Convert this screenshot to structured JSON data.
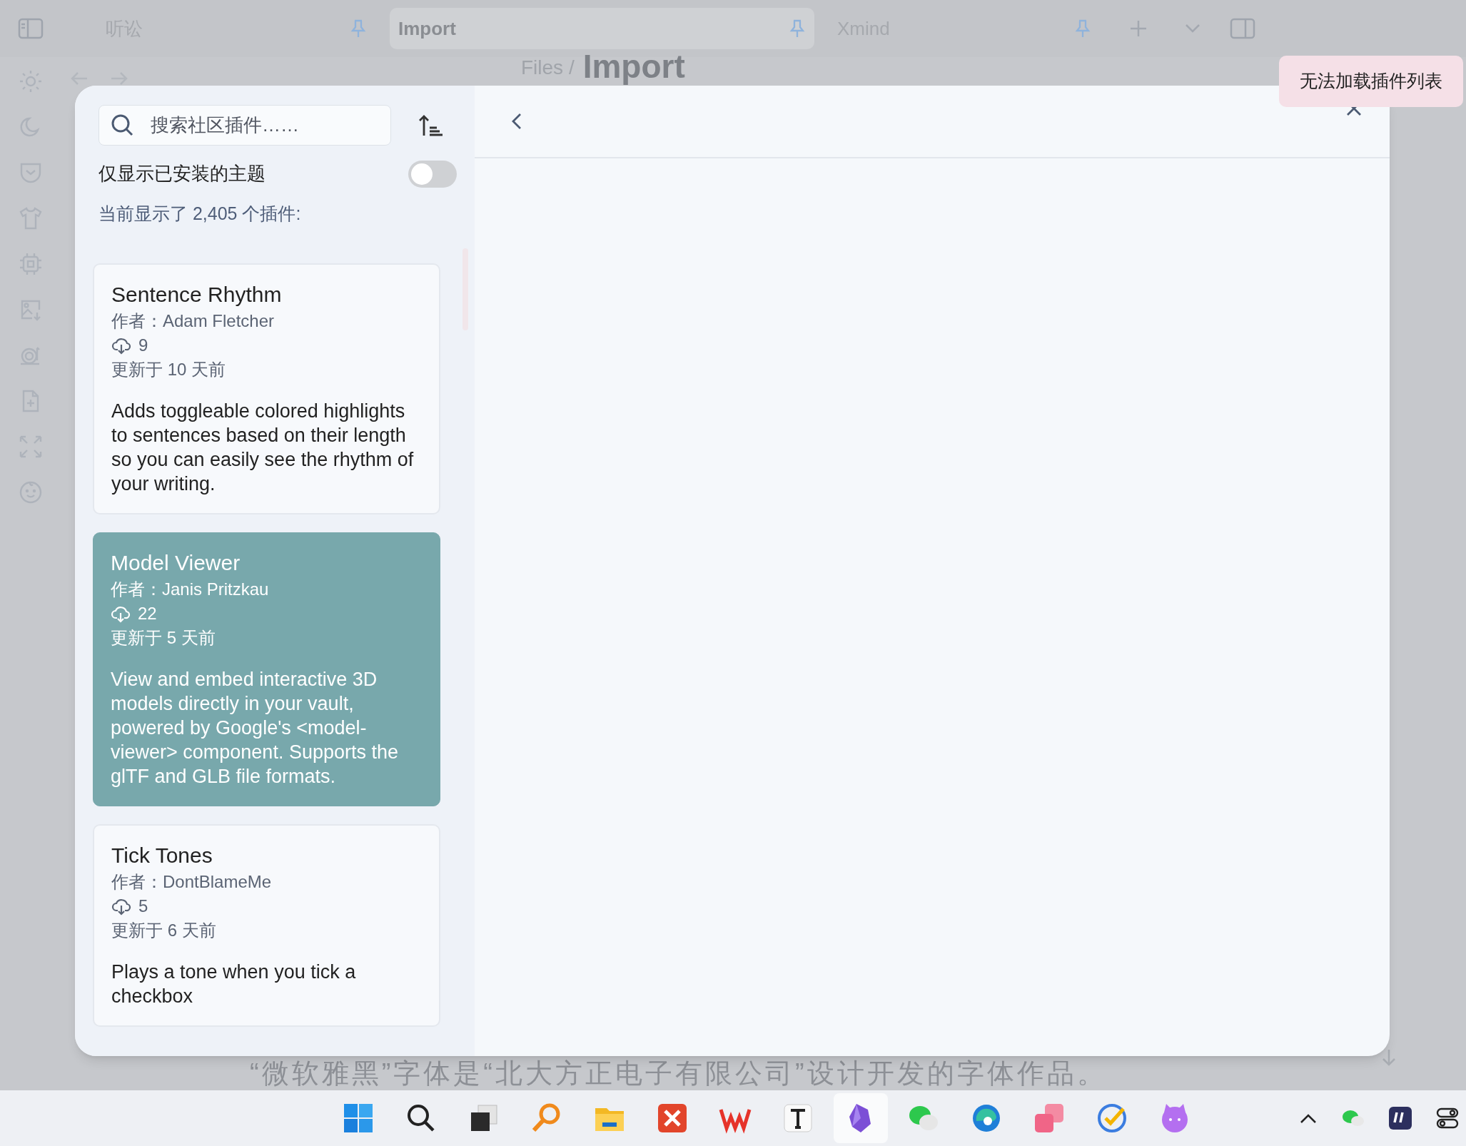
{
  "tabs": [
    {
      "label": "听讼",
      "pinned": true,
      "selected": false
    },
    {
      "label": "Import",
      "pinned": true,
      "selected": true
    },
    {
      "label": "Xmind",
      "pinned": true,
      "selected": false
    }
  ],
  "breadcrumb": {
    "parent": "Files /",
    "current": "Import"
  },
  "background_text": "“微软雅黑”字体是“北大方正电子有限公司”设计开发的字体作品。",
  "modal": {
    "search": {
      "placeholder": "搜索社区插件……"
    },
    "installed_only": {
      "label": "仅显示已安装的主题",
      "on": false
    },
    "count": "当前显示了 2,405 个插件:",
    "plugins": [
      {
        "name": "Sentence Rhythm",
        "author": "作者：Adam Fletcher",
        "downloads": "9",
        "updated": "更新于 10 天前",
        "description": "Adds toggleable colored highlights to sentences based on their length so you can easily see the rhythm of your writing.",
        "selected": false
      },
      {
        "name": "Model Viewer",
        "author": "作者：Janis Pritzkau",
        "downloads": "22",
        "updated": "更新于 5 天前",
        "description": "View and embed interactive 3D models directly in your vault, powered by Google's <model-viewer> component. Supports the glTF and GLB file formats.",
        "selected": true
      },
      {
        "name": "Tick Tones",
        "author": "作者：DontBlameMe",
        "downloads": "5",
        "updated": "更新于 6 天前",
        "description": "Plays a tone when you tick a checkbox",
        "selected": false
      }
    ]
  },
  "notice": "无法加载插件列表",
  "taskbar": [
    {
      "kind": "start",
      "selected": false
    },
    {
      "kind": "search",
      "selected": false
    },
    {
      "kind": "taskview",
      "selected": false
    },
    {
      "kind": "magnifier",
      "selected": false
    },
    {
      "kind": "folder",
      "selected": false
    },
    {
      "kind": "xmind",
      "selected": false
    },
    {
      "kind": "wps",
      "selected": false
    },
    {
      "kind": "typora",
      "selected": false
    },
    {
      "kind": "obsidian",
      "selected": true
    },
    {
      "kind": "chat",
      "selected": false
    },
    {
      "kind": "edge",
      "selected": false
    },
    {
      "kind": "squares",
      "selected": false
    },
    {
      "kind": "todo",
      "selected": false
    },
    {
      "kind": "cat",
      "selected": false
    }
  ]
}
